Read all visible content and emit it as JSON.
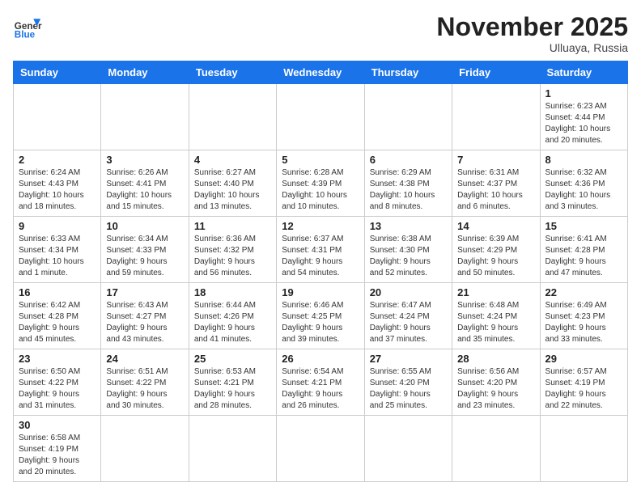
{
  "header": {
    "logo_general": "General",
    "logo_blue": "Blue",
    "month_title": "November 2025",
    "location": "Ulluaya, Russia"
  },
  "weekdays": [
    "Sunday",
    "Monday",
    "Tuesday",
    "Wednesday",
    "Thursday",
    "Friday",
    "Saturday"
  ],
  "weeks": [
    [
      {
        "day": "",
        "info": ""
      },
      {
        "day": "",
        "info": ""
      },
      {
        "day": "",
        "info": ""
      },
      {
        "day": "",
        "info": ""
      },
      {
        "day": "",
        "info": ""
      },
      {
        "day": "",
        "info": ""
      },
      {
        "day": "1",
        "info": "Sunrise: 6:23 AM\nSunset: 4:44 PM\nDaylight: 10 hours\nand 20 minutes."
      }
    ],
    [
      {
        "day": "2",
        "info": "Sunrise: 6:24 AM\nSunset: 4:43 PM\nDaylight: 10 hours\nand 18 minutes."
      },
      {
        "day": "3",
        "info": "Sunrise: 6:26 AM\nSunset: 4:41 PM\nDaylight: 10 hours\nand 15 minutes."
      },
      {
        "day": "4",
        "info": "Sunrise: 6:27 AM\nSunset: 4:40 PM\nDaylight: 10 hours\nand 13 minutes."
      },
      {
        "day": "5",
        "info": "Sunrise: 6:28 AM\nSunset: 4:39 PM\nDaylight: 10 hours\nand 10 minutes."
      },
      {
        "day": "6",
        "info": "Sunrise: 6:29 AM\nSunset: 4:38 PM\nDaylight: 10 hours\nand 8 minutes."
      },
      {
        "day": "7",
        "info": "Sunrise: 6:31 AM\nSunset: 4:37 PM\nDaylight: 10 hours\nand 6 minutes."
      },
      {
        "day": "8",
        "info": "Sunrise: 6:32 AM\nSunset: 4:36 PM\nDaylight: 10 hours\nand 3 minutes."
      }
    ],
    [
      {
        "day": "9",
        "info": "Sunrise: 6:33 AM\nSunset: 4:34 PM\nDaylight: 10 hours\nand 1 minute."
      },
      {
        "day": "10",
        "info": "Sunrise: 6:34 AM\nSunset: 4:33 PM\nDaylight: 9 hours\nand 59 minutes."
      },
      {
        "day": "11",
        "info": "Sunrise: 6:36 AM\nSunset: 4:32 PM\nDaylight: 9 hours\nand 56 minutes."
      },
      {
        "day": "12",
        "info": "Sunrise: 6:37 AM\nSunset: 4:31 PM\nDaylight: 9 hours\nand 54 minutes."
      },
      {
        "day": "13",
        "info": "Sunrise: 6:38 AM\nSunset: 4:30 PM\nDaylight: 9 hours\nand 52 minutes."
      },
      {
        "day": "14",
        "info": "Sunrise: 6:39 AM\nSunset: 4:29 PM\nDaylight: 9 hours\nand 50 minutes."
      },
      {
        "day": "15",
        "info": "Sunrise: 6:41 AM\nSunset: 4:28 PM\nDaylight: 9 hours\nand 47 minutes."
      }
    ],
    [
      {
        "day": "16",
        "info": "Sunrise: 6:42 AM\nSunset: 4:28 PM\nDaylight: 9 hours\nand 45 minutes."
      },
      {
        "day": "17",
        "info": "Sunrise: 6:43 AM\nSunset: 4:27 PM\nDaylight: 9 hours\nand 43 minutes."
      },
      {
        "day": "18",
        "info": "Sunrise: 6:44 AM\nSunset: 4:26 PM\nDaylight: 9 hours\nand 41 minutes."
      },
      {
        "day": "19",
        "info": "Sunrise: 6:46 AM\nSunset: 4:25 PM\nDaylight: 9 hours\nand 39 minutes."
      },
      {
        "day": "20",
        "info": "Sunrise: 6:47 AM\nSunset: 4:24 PM\nDaylight: 9 hours\nand 37 minutes."
      },
      {
        "day": "21",
        "info": "Sunrise: 6:48 AM\nSunset: 4:24 PM\nDaylight: 9 hours\nand 35 minutes."
      },
      {
        "day": "22",
        "info": "Sunrise: 6:49 AM\nSunset: 4:23 PM\nDaylight: 9 hours\nand 33 minutes."
      }
    ],
    [
      {
        "day": "23",
        "info": "Sunrise: 6:50 AM\nSunset: 4:22 PM\nDaylight: 9 hours\nand 31 minutes."
      },
      {
        "day": "24",
        "info": "Sunrise: 6:51 AM\nSunset: 4:22 PM\nDaylight: 9 hours\nand 30 minutes."
      },
      {
        "day": "25",
        "info": "Sunrise: 6:53 AM\nSunset: 4:21 PM\nDaylight: 9 hours\nand 28 minutes."
      },
      {
        "day": "26",
        "info": "Sunrise: 6:54 AM\nSunset: 4:21 PM\nDaylight: 9 hours\nand 26 minutes."
      },
      {
        "day": "27",
        "info": "Sunrise: 6:55 AM\nSunset: 4:20 PM\nDaylight: 9 hours\nand 25 minutes."
      },
      {
        "day": "28",
        "info": "Sunrise: 6:56 AM\nSunset: 4:20 PM\nDaylight: 9 hours\nand 23 minutes."
      },
      {
        "day": "29",
        "info": "Sunrise: 6:57 AM\nSunset: 4:19 PM\nDaylight: 9 hours\nand 22 minutes."
      }
    ],
    [
      {
        "day": "30",
        "info": "Sunrise: 6:58 AM\nSunset: 4:19 PM\nDaylight: 9 hours\nand 20 minutes."
      },
      {
        "day": "",
        "info": ""
      },
      {
        "day": "",
        "info": ""
      },
      {
        "day": "",
        "info": ""
      },
      {
        "day": "",
        "info": ""
      },
      {
        "day": "",
        "info": ""
      },
      {
        "day": "",
        "info": ""
      }
    ]
  ]
}
